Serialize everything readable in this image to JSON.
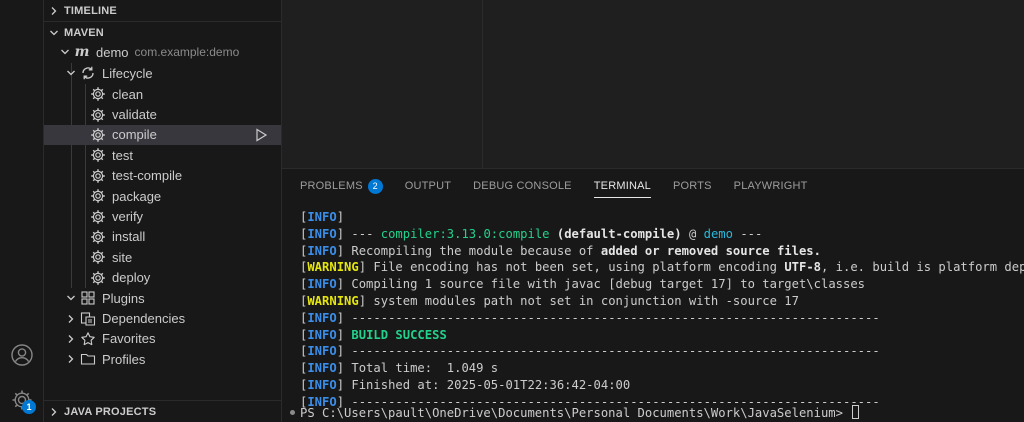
{
  "sidebar": {
    "timeline_header": "TIMELINE",
    "maven_header": "MAVEN",
    "java_projects_header": "JAVA PROJECTS",
    "project": {
      "name": "demo",
      "coordinates": "com.example:demo"
    },
    "lifecycle_label": "Lifecycle",
    "phases": [
      "clean",
      "validate",
      "compile",
      "test",
      "test-compile",
      "package",
      "verify",
      "install",
      "site",
      "deploy"
    ],
    "selected_phase": "compile",
    "nodes": [
      "Plugins",
      "Dependencies",
      "Favorites",
      "Profiles"
    ]
  },
  "activity": {
    "manage_badge": "1"
  },
  "panel": {
    "tabs": [
      "PROBLEMS",
      "OUTPUT",
      "DEBUG CONSOLE",
      "TERMINAL",
      "PORTS",
      "PLAYWRIGHT"
    ],
    "problems_count": "2",
    "active_tab": "TERMINAL"
  },
  "terminal": {
    "level_info": "INFO",
    "level_warning": "WARNING",
    "l2_dashes": "--- ",
    "l2_plugin": "compiler:3.13.0:compile",
    "l2_exec": "(default-compile)",
    "l2_at": " @ ",
    "l2_project": "demo",
    "l2_end": " ---",
    "l3_text": " Recompiling the module because of ",
    "l3_bold": "added or removed source files.",
    "l4_text_a": " File encoding has not been set, using platform encoding ",
    "l4_bold": "UTF-8",
    "l4_text_b": ", i.e. build is platform dependent!",
    "l5_text": " Compiling 1 source file with javac [debug target 17] to target\\classes",
    "l6_text": " system modules path not set in conjunction with -source 17",
    "separator": " ------------------------------------------------------------------------",
    "build_success": "BUILD SUCCESS",
    "total_time": " Total time:  1.049 s",
    "finished_at": " Finished at: 2025-05-01T22:36:42-04:00",
    "prompt": "PS C:\\Users\\pault\\OneDrive\\Documents\\Personal Documents\\Work\\JavaSelenium> "
  }
}
